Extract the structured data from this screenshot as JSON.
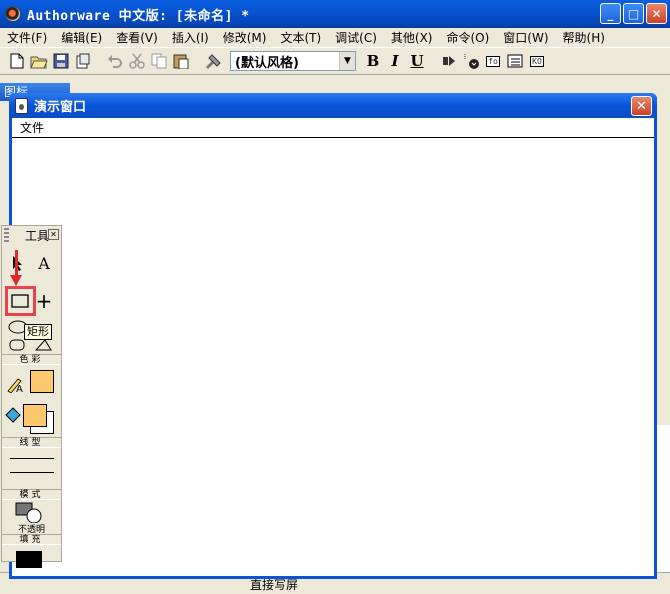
{
  "window": {
    "title": "Authorware 中文版: [未命名] *",
    "minimize": "_",
    "maximize": "□",
    "close": "✕"
  },
  "menu": [
    "文件(F)",
    "编辑(E)",
    "查看(V)",
    "插入(I)",
    "修改(M)",
    "文本(T)",
    "调试(C)",
    "其他(X)",
    "命令(O)",
    "窗口(W)",
    "帮助(H)"
  ],
  "toolbar": {
    "style_value": "(默认风格)",
    "bold": "B",
    "italic": "I",
    "underline": "U",
    "fn_label": "fo",
    "ko_label": "KO"
  },
  "background": {
    "panel_title": "图标",
    "status_text": "直接写屏"
  },
  "presentation": {
    "title": "演示窗口",
    "close": "✕",
    "menu_file": "文件"
  },
  "tools": {
    "title": "工具",
    "close": "✕",
    "text_tool": "A",
    "plus_tool": "+",
    "tooltip": "矩形",
    "color_label": "色彩",
    "text_color_letter": "A",
    "line_label": "线型",
    "mode_label": "模式",
    "mode_value": "不透明",
    "fill_label": "填充"
  },
  "colors": {
    "title_blue": "#0853d2",
    "highlight_red": "#e8424c",
    "swatch_orange": "#fdc86e",
    "fill_black": "#000000"
  }
}
